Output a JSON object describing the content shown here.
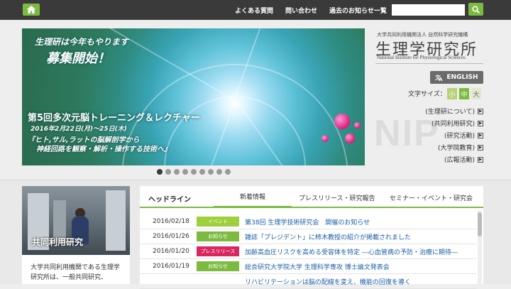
{
  "topbar": {
    "nav": [
      "よくある質問",
      "問い合わせ",
      "過去のお知らせ一覧"
    ],
    "search": {
      "value": "",
      "placeholder": ""
    }
  },
  "hero": {
    "line1": "生理研は今年もやります",
    "line2": "募集開始！",
    "line3": "第5回多次元脳トレーニング＆レクチャー",
    "line4": "2016年2月22日(月)〜25日(木)",
    "line5a": "『ヒト,サル,ラットの脳解剖学から",
    "line5b": "神経回路を観察・解析・操作する技術へ』",
    "slides_total": 9,
    "active_slide": 1
  },
  "logo": {
    "small": "大学共同利用機関法人 自然科学研究機構",
    "main": "生理学研究所",
    "en": "National Institute for Physiological Sciences"
  },
  "lang": {
    "english_label": "ENGLISH"
  },
  "fontsize": {
    "label": "文字サイズ：",
    "small": "小",
    "medium": "中",
    "large": "大"
  },
  "watermark": "NIP",
  "sidelinks": [
    "(生理研について)",
    "(共同利用研究)",
    "(研究活動)",
    "(大学院教育)",
    "(広報活動)"
  ],
  "card": {
    "title": "共同利用研究",
    "text": "大学共同利用機関である生理学研究所は、一般共同研究、"
  },
  "news": {
    "tabs": [
      "ヘッドライン",
      "新着情報",
      "プレスリリース・研究報告",
      "セミナー・イベント・研究会"
    ],
    "rows": [
      {
        "date": "2016/02/18",
        "badge": "イベント",
        "color": "#9fcf3c",
        "title": "第38回 生理学技術研究会　開催のお知らせ"
      },
      {
        "date": "2016/01/26",
        "badge": "お知らせ",
        "color": "#7cbb3f",
        "title": "雑誌「プレジデント」に柿木教授の紹介が掲載されました"
      },
      {
        "date": "2016/01/20",
        "badge": "プレスリリース",
        "color": "#d9265e",
        "title": "加齢高血圧リスクを高める受容体を特定 ―心血管病の予防・治療に期待―"
      },
      {
        "date": "2016/01/19",
        "badge": "お知らせ",
        "color": "#7cbb3f",
        "title": "総合研究大学院大学 生理科学専攻 博士論文発表会"
      },
      {
        "date": "",
        "badge": "",
        "color": "#ffffff",
        "title": "リハビリテーションは脳の配線を変え、機能の回復を導く"
      }
    ]
  }
}
